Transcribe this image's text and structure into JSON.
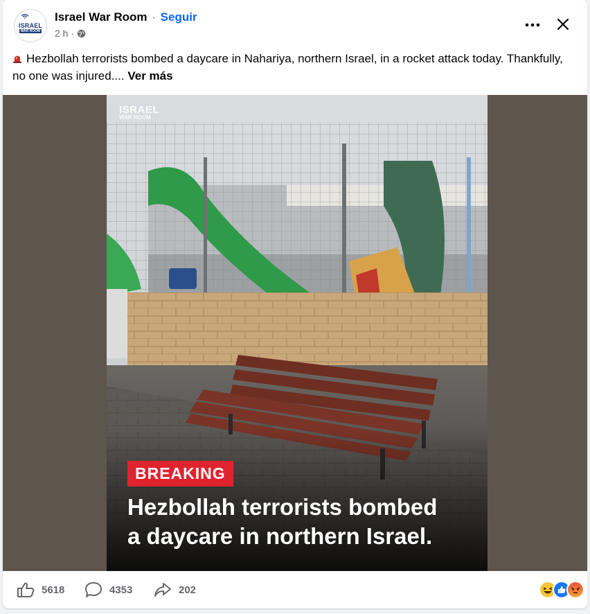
{
  "post": {
    "page_name": "Israel War Room",
    "separator": "·",
    "follow_label": "Seguir",
    "time": "2 h ·",
    "avatar": {
      "line1": "ISRAEL",
      "line2": "WAR ROOM"
    },
    "text": "Hezbollah terrorists bombed a daycare in Nahariya, northern Israel, in a rocket attack today. Thankfully, no one was injured....",
    "see_more": "Ver más",
    "icons": {
      "more": "more-dots-icon",
      "close": "close-icon",
      "audience": "globe-icon",
      "emoji": "siren-icon"
    }
  },
  "media": {
    "watermark_line1": "ISRAEL",
    "watermark_line2": "WAR ROOM",
    "badge": "BREAKING",
    "headline_line1": "Hezbollah terrorists bombed",
    "headline_line2": "a daycare in northern Israel."
  },
  "engagement": {
    "likes": "5618",
    "comments": "4353",
    "shares": "202",
    "reactions": [
      "laugh",
      "like",
      "angry"
    ]
  },
  "colors": {
    "accent": "#0866ff",
    "breaking_red": "#e0242f",
    "frame": "#5e554d"
  }
}
